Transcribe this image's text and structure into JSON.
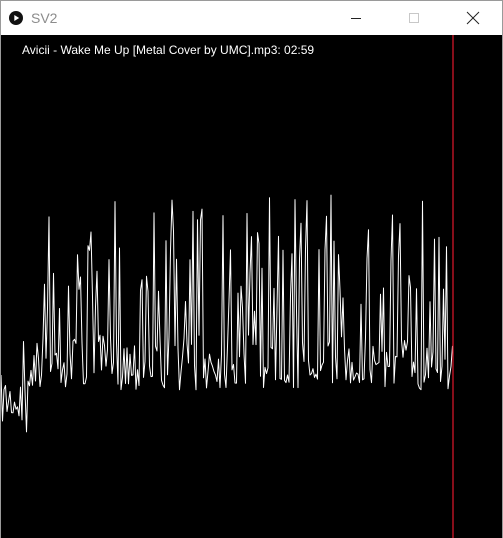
{
  "window": {
    "title": "SV2",
    "app_icon": "play-circle-icon",
    "controls": {
      "minimize_icon": "minimize-icon",
      "maximize_icon": "maximize-icon",
      "close_icon": "close-icon"
    }
  },
  "player": {
    "track_label": "Avicii - Wake Me Up [Metal Cover by UMC].mp3: 02:59",
    "playhead_color": "#e0182b",
    "wave_color": "#ffffff",
    "background_color": "#000000"
  }
}
